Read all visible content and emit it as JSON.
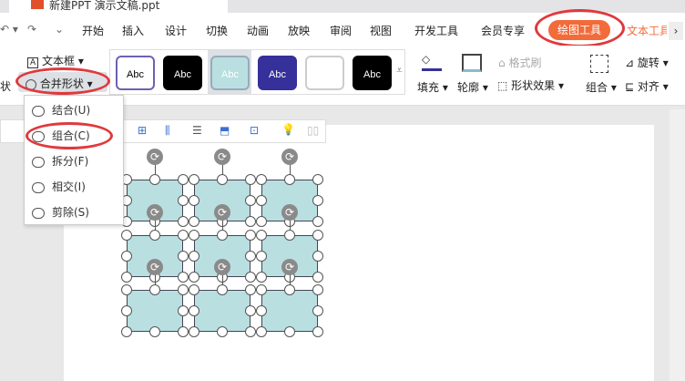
{
  "title_tab": {
    "filename": "新建PPT 演示文稿.ppt"
  },
  "menu": [
    "开始",
    "插入",
    "设计",
    "切换",
    "动画",
    "放映",
    "审阅",
    "视图",
    "开发工具",
    "会员专享"
  ],
  "active_tab": "绘图工具",
  "next_tab": "文本工具",
  "ribbon": {
    "textbox": "文本框",
    "merge_shapes": "合并形状",
    "shape_partial": "状",
    "style_label": "Abc",
    "fill": "填充",
    "outline": "轮廓",
    "format_painter": "格式刷",
    "shape_effects": "形状效果",
    "group": "组合",
    "rotate": "旋转",
    "align": "对齐"
  },
  "styles": [
    {
      "bg": "#ffffff",
      "fg": "#000",
      "border": "#6b63b0"
    },
    {
      "bg": "#000000",
      "fg": "#fff",
      "border": "#000"
    },
    {
      "bg": "#b9dfe1",
      "fg": "#fff",
      "border": "#9ab"
    },
    {
      "bg": "#35309a",
      "fg": "#fff",
      "border": "#35309a"
    },
    {
      "bg": "#ffffff",
      "fg": "#fff",
      "border": "#ccc"
    },
    {
      "bg": "#000000",
      "fg": "#fff",
      "border": "#000"
    }
  ],
  "dropdown": [
    "结合(U)",
    "组合(C)",
    "拆分(F)",
    "相交(I)",
    "剪除(S)"
  ],
  "accent": "#f26b3a"
}
